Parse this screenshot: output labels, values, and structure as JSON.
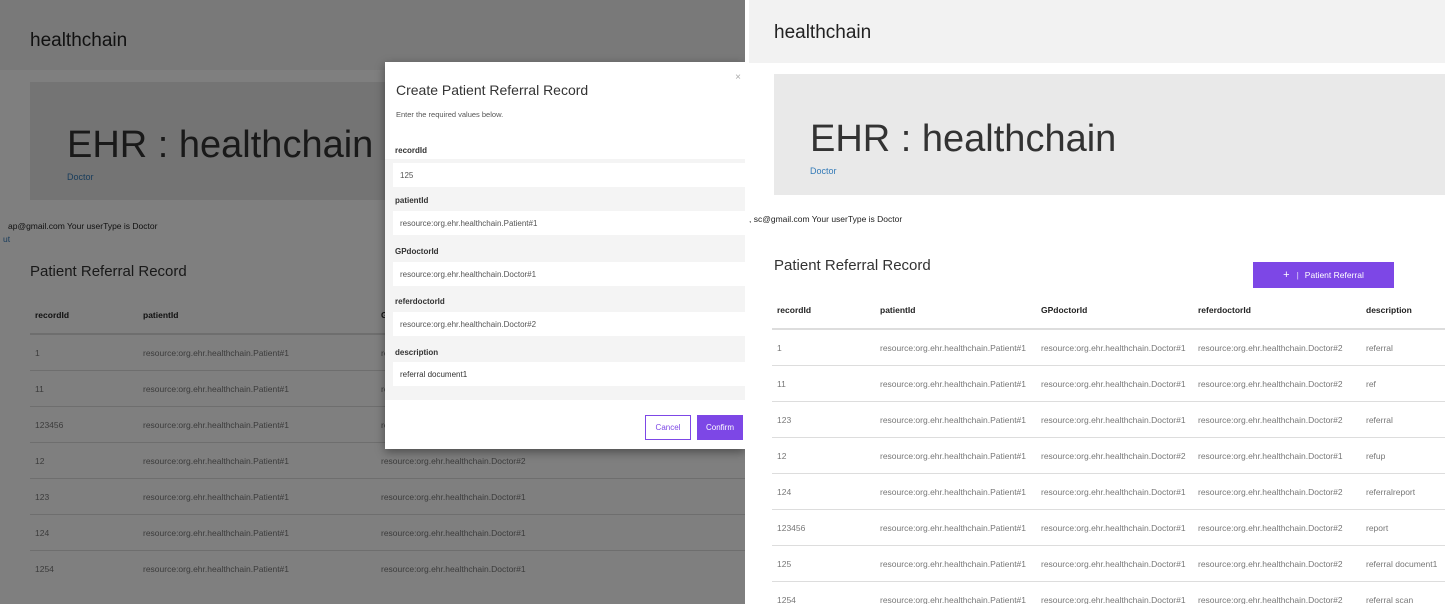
{
  "app": {
    "brand": "healthchain",
    "jumbotron_title": "EHR : healthchain",
    "jumbotron_subtitle": "Doctor",
    "section_title": "Patient Referral Record"
  },
  "left": {
    "welcome": "ap@gmail.com Your userType is Doctor",
    "logout": "ut",
    "table": {
      "headers": [
        "recordId",
        "patientId",
        "GP"
      ],
      "rows": [
        [
          "1",
          "resource:org.ehr.healthchain.Patient#1",
          "re"
        ],
        [
          "11",
          "resource:org.ehr.healthchain.Patient#1",
          "re"
        ],
        [
          "123456",
          "resource:org.ehr.healthchain.Patient#1",
          "re"
        ],
        [
          "12",
          "resource:org.ehr.healthchain.Patient#1",
          "resource:org.ehr.healthchain.Doctor#2"
        ],
        [
          "123",
          "resource:org.ehr.healthchain.Patient#1",
          "resource:org.ehr.healthchain.Doctor#1"
        ],
        [
          "124",
          "resource:org.ehr.healthchain.Patient#1",
          "resource:org.ehr.healthchain.Doctor#1"
        ],
        [
          "1254",
          "resource:org.ehr.healthchain.Patient#1",
          "resource:org.ehr.healthchain.Doctor#1"
        ]
      ]
    }
  },
  "modal": {
    "title": "Create Patient Referral Record",
    "subtitle": "Enter the required values below.",
    "close": "×",
    "fields": [
      {
        "label": "recordId",
        "value": "125"
      },
      {
        "label": "patientId",
        "value": "resource:org.ehr.healthchain.Patient#1"
      },
      {
        "label": "GPdoctorId",
        "value": "resource:org.ehr.healthchain.Doctor#1"
      },
      {
        "label": "referdoctorId",
        "value": "resource:org.ehr.healthchain.Doctor#2"
      },
      {
        "label": "description",
        "value": "referral document1"
      }
    ],
    "cancel": "Cancel",
    "confirm": "Confirm"
  },
  "right": {
    "welcome": ", sc@gmail.com Your userType is Doctor",
    "add_button": {
      "icon": "+",
      "label": "Patient Referral"
    },
    "table": {
      "headers": [
        "recordId",
        "patientId",
        "GPdoctorId",
        "referdoctorId",
        "description"
      ],
      "rows": [
        [
          "1",
          "resource:org.ehr.healthchain.Patient#1",
          "resource:org.ehr.healthchain.Doctor#1",
          "resource:org.ehr.healthchain.Doctor#2",
          "referral"
        ],
        [
          "11",
          "resource:org.ehr.healthchain.Patient#1",
          "resource:org.ehr.healthchain.Doctor#1",
          "resource:org.ehr.healthchain.Doctor#2",
          "ref"
        ],
        [
          "123",
          "resource:org.ehr.healthchain.Patient#1",
          "resource:org.ehr.healthchain.Doctor#1",
          "resource:org.ehr.healthchain.Doctor#2",
          "referral"
        ],
        [
          "12",
          "resource:org.ehr.healthchain.Patient#1",
          "resource:org.ehr.healthchain.Doctor#2",
          "resource:org.ehr.healthchain.Doctor#1",
          "refup"
        ],
        [
          "124",
          "resource:org.ehr.healthchain.Patient#1",
          "resource:org.ehr.healthchain.Doctor#1",
          "resource:org.ehr.healthchain.Doctor#2",
          "referralreport"
        ],
        [
          "123456",
          "resource:org.ehr.healthchain.Patient#1",
          "resource:org.ehr.healthchain.Doctor#1",
          "resource:org.ehr.healthchain.Doctor#2",
          "report"
        ],
        [
          "125",
          "resource:org.ehr.healthchain.Patient#1",
          "resource:org.ehr.healthchain.Doctor#1",
          "resource:org.ehr.healthchain.Doctor#2",
          "referral document1"
        ],
        [
          "1254",
          "resource:org.ehr.healthchain.Patient#1",
          "resource:org.ehr.healthchain.Doctor#1",
          "resource:org.ehr.healthchain.Doctor#2",
          "referral scan"
        ]
      ]
    }
  },
  "colors": {
    "accent": "#7d47e6",
    "link": "#337ab7",
    "navbar": "#f2f2f2",
    "jumbotron": "#e9e9e9"
  }
}
